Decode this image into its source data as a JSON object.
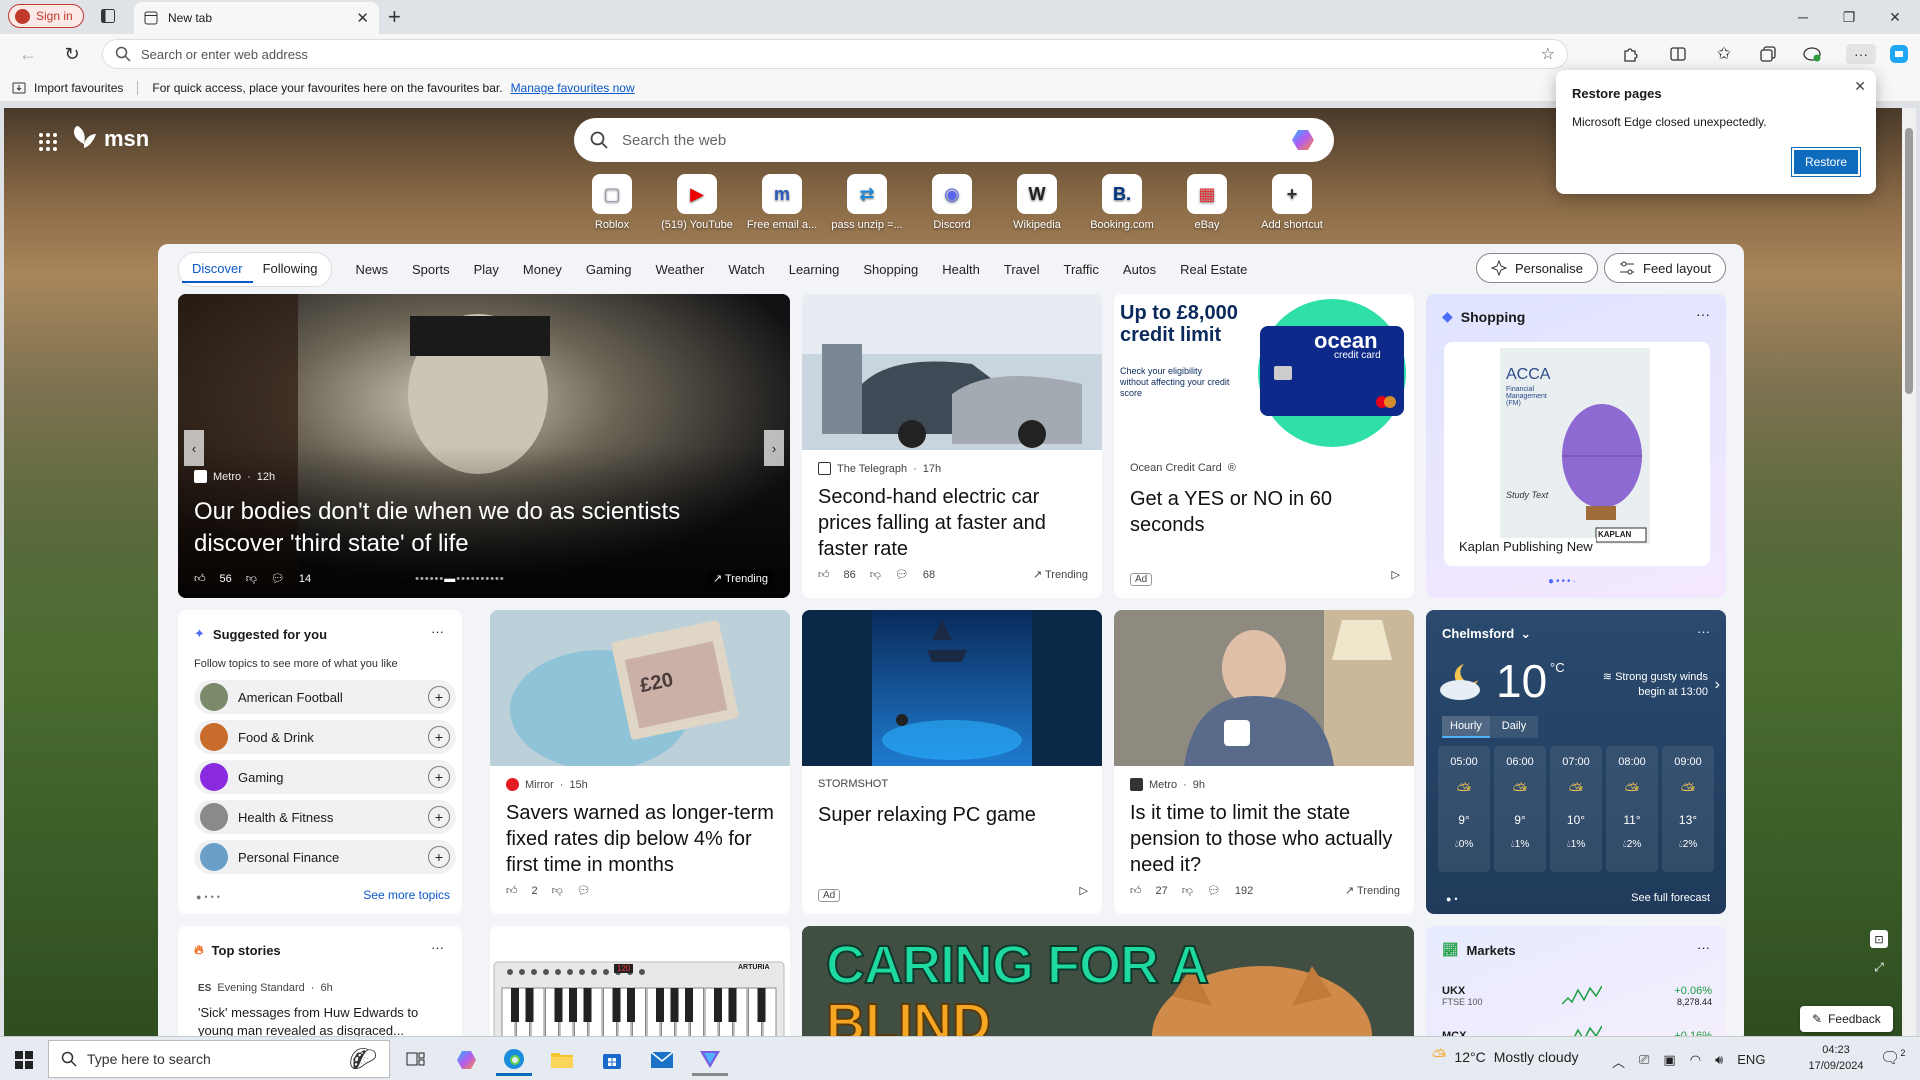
{
  "browser": {
    "sign_in": "Sign in",
    "tab_title": "New tab",
    "address_placeholder": "Search or enter web address",
    "import_favourites": "Import favourites",
    "favbar_message": "For quick access, place your favourites here on the favourites bar.",
    "manage_favourites": "Manage favourites now"
  },
  "popup": {
    "title": "Restore pages",
    "message": "Microsoft Edge closed unexpectedly.",
    "restore": "Restore"
  },
  "msn": {
    "logo": "msn",
    "search_placeholder": "Search the web",
    "shortcuts": [
      {
        "label": "Roblox",
        "glyph": "▢",
        "color": "#8a97a6"
      },
      {
        "label": "(519) YouTube",
        "glyph": "▶",
        "color": "#e00"
      },
      {
        "label": "Free email a...",
        "glyph": "m",
        "color": "#2b5ab8"
      },
      {
        "label": "pass unzip =...",
        "glyph": "⇄",
        "color": "#1f86d4"
      },
      {
        "label": "Discord",
        "glyph": "◉",
        "color": "#5865f2"
      },
      {
        "label": "Wikipedia",
        "glyph": "W",
        "color": "#222"
      },
      {
        "label": "Booking.com",
        "glyph": "B.",
        "color": "#003580"
      },
      {
        "label": "eBay",
        "glyph": "▦",
        "color": "#e53238"
      },
      {
        "label": "Add shortcut",
        "glyph": "+",
        "color": "#333"
      }
    ]
  },
  "nav": {
    "discover": "Discover",
    "following": "Following",
    "items": [
      "News",
      "Sports",
      "Play",
      "Money",
      "Gaming",
      "Weather",
      "Watch",
      "Learning",
      "Shopping",
      "Health",
      "Travel",
      "Traffic",
      "Autos",
      "Real Estate"
    ],
    "personalise": "Personalise",
    "feed_layout": "Feed layout"
  },
  "hero": {
    "source": "Metro",
    "time": "12h",
    "headline": "Our bodies don't die when we do as scientists discover 'third state' of life",
    "likes": "56",
    "comments": "14",
    "trending": "Trending"
  },
  "telegraph": {
    "source": "The Telegraph",
    "time": "17h",
    "headline": "Second-hand electric car prices falling at faster and faster rate",
    "likes": "86",
    "comments": "68",
    "trending": "Trending"
  },
  "ocean_ad": {
    "banner_title": "Up to £8,000 credit limit",
    "banner_sub": "Check your eligibility without affecting your credit score",
    "card_brand": "ocean",
    "card_sub": "credit card",
    "source": "Ocean Credit Card",
    "headline": "Get a YES or NO in 60 seconds",
    "ad": "Ad"
  },
  "shopping": {
    "title": "Shopping",
    "book_title": "ACCA",
    "book_sub": "Financial Management (FM)",
    "book_label": "Study Text",
    "publisher": "KAPLAN",
    "caption": "Kaplan Publishing New"
  },
  "suggested": {
    "title": "Suggested for you",
    "subtitle": "Follow topics to see more of what you like",
    "topics": [
      "American Football",
      "Food & Drink",
      "Gaming",
      "Health & Fitness",
      "Personal Finance"
    ],
    "see_more": "See more topics"
  },
  "mirror": {
    "source": "Mirror",
    "time": "15h",
    "headline": "Savers warned as longer-term fixed rates dip below 4% for first time in months",
    "likes": "2",
    "image_text": "£20"
  },
  "stormshot": {
    "source": "STORMSHOT",
    "headline": "Super relaxing PC game",
    "ad": "Ad"
  },
  "pension": {
    "source": "Metro",
    "time": "9h",
    "headline": "Is it time to limit the state pension to those who actually need it?",
    "likes": "27",
    "comments": "192",
    "trending": "Trending"
  },
  "weather": {
    "location": "Chelmsford",
    "temp": "10",
    "unit": "°C",
    "alert": "Strong gusty winds begin at 13:00",
    "tab_hourly": "Hourly",
    "tab_daily": "Daily",
    "hours": [
      {
        "time": "05:00",
        "temp": "9°",
        "rain": "0%"
      },
      {
        "time": "06:00",
        "temp": "9°",
        "rain": "1%"
      },
      {
        "time": "07:00",
        "temp": "10°",
        "rain": "1%"
      },
      {
        "time": "08:00",
        "temp": "11°",
        "rain": "2%"
      },
      {
        "time": "09:00",
        "temp": "13°",
        "rain": "2%"
      }
    ],
    "full_forecast": "See full forecast"
  },
  "top_stories": {
    "title": "Top stories",
    "source": "Evening Standard",
    "time": "6h",
    "headline": "'Sick' messages from Huw Edwards to young man revealed as disgraced..."
  },
  "piano": {
    "brand": "ARTURIA",
    "display": "120"
  },
  "cat_card": {
    "image_text_1": "CARING FOR A",
    "image_text_2": "BLIND"
  },
  "markets": {
    "title": "Markets",
    "rows": [
      {
        "name": "UKX",
        "sub": "FTSE 100",
        "change": "+0.06%",
        "value": "8,278.44"
      },
      {
        "name": "MCX",
        "sub": "",
        "change": "+0.16%",
        "value": ""
      }
    ]
  },
  "feedback": "Feedback",
  "taskbar": {
    "search_placeholder": "Type here to search",
    "temp": "12°C",
    "condition": "Mostly cloudy",
    "lang": "ENG",
    "time": "04:23",
    "date": "17/09/2024",
    "notif_count": "2"
  },
  "colors": {
    "accent": "#0f6cbd",
    "sign_in_red": "#c0392b",
    "weather_bg": "#2a4a6e"
  }
}
